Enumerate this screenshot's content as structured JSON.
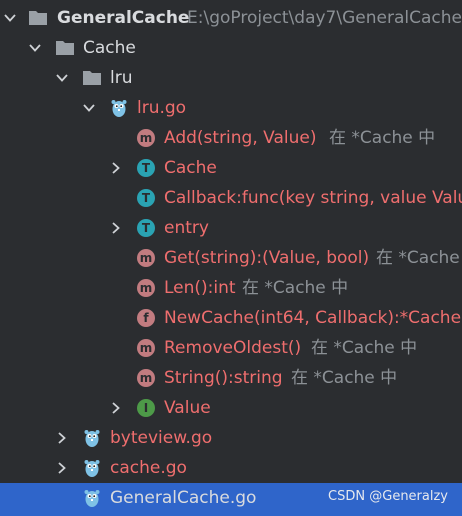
{
  "root": {
    "name": "GeneralCache",
    "path": "E:\\goProject\\day7\\GeneralCache"
  },
  "folder_cache": "Cache",
  "folder_lru": "lru",
  "file_lru": "lru.go",
  "members": {
    "add": {
      "label": "Add(string, Value)",
      "hint": "在 *Cache 中"
    },
    "cache": {
      "label": "Cache"
    },
    "callback": {
      "label": "Callback:func(key string, value Value)"
    },
    "entry": {
      "label": "entry"
    },
    "get": {
      "label": "Get(string):(Value, bool)",
      "hint": "在 *Cache 中"
    },
    "len": {
      "label": "Len():int",
      "hint": "在 *Cache 中"
    },
    "newcache": {
      "label": "NewCache(int64, Callback):*Cache"
    },
    "removeoldest": {
      "label": "RemoveOldest()",
      "hint": "在 *Cache 中"
    },
    "string": {
      "label": "String():string",
      "hint": "在 *Cache 中"
    },
    "value": {
      "label": "Value"
    }
  },
  "files": {
    "byteview": "byteview.go",
    "cache": "cache.go",
    "generalcache": "GeneralCache.go"
  },
  "badges": {
    "method": "m",
    "type": "T",
    "func": "f",
    "interface": "I"
  },
  "watermark": "CSDN @Generalzy",
  "colors": {
    "background": "#2b2d30",
    "selection": "#2f65ca",
    "file_error_red": "#ef6e6e",
    "method_badge": "#c27c80",
    "type_badge": "#2aa3b3",
    "interface_badge": "#4d9a48",
    "go_gopher": "#7fc2e6"
  },
  "icons": {
    "expanded": "chevron-down-icon",
    "collapsed": "chevron-right-icon",
    "folder": "folder-icon",
    "go_file": "go-gopher-icon"
  }
}
